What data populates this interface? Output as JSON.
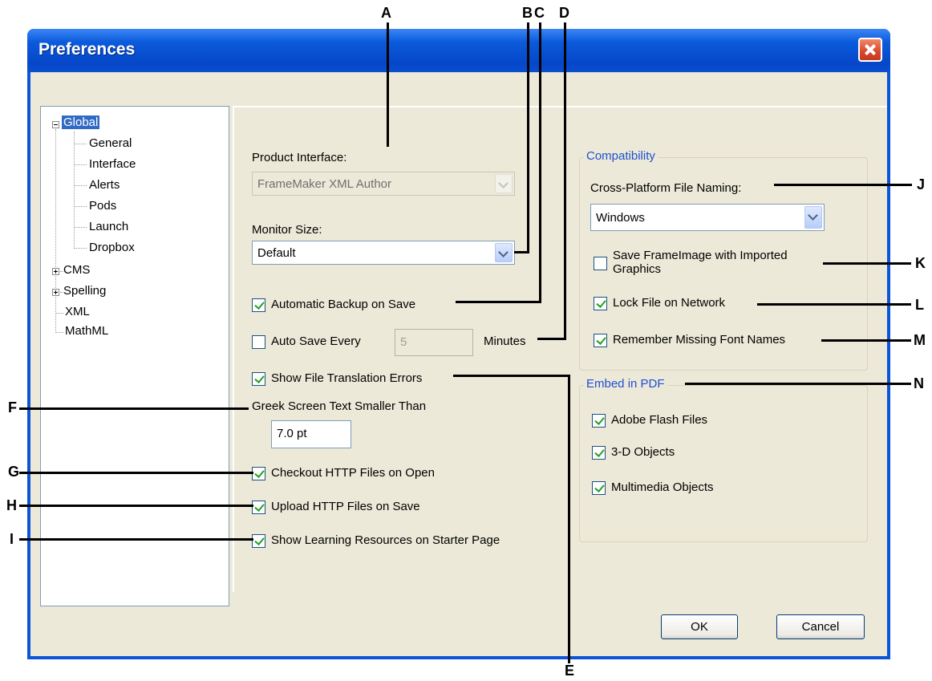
{
  "window": {
    "title": "Preferences"
  },
  "tree": {
    "root": "Global",
    "children": [
      "General",
      "Interface",
      "Alerts",
      "Pods",
      "Launch",
      "Dropbox"
    ],
    "others": [
      "CMS",
      "Spelling",
      "XML",
      "MathML"
    ]
  },
  "product_interface": {
    "label": "Product Interface:",
    "value": "FrameMaker XML Author"
  },
  "monitor_size": {
    "label": "Monitor Size:",
    "value": "Default"
  },
  "options": {
    "auto_backup": "Automatic Backup on Save",
    "auto_save": "Auto Save Every",
    "auto_save_value": "5",
    "minutes": "Minutes",
    "show_translation_errors": "Show File Translation Errors",
    "greek_label": "Greek Screen Text Smaller Than",
    "greek_value": "7.0 pt",
    "checkout_http": "Checkout HTTP Files on Open",
    "upload_http": "Upload HTTP Files on Save",
    "learning_resources": "Show Learning Resources on Starter Page"
  },
  "compatibility": {
    "title": "Compatibility",
    "naming_label": "Cross-Platform File Naming:",
    "naming_value": "Windows",
    "save_frameimage_line1": "Save FrameImage with Imported",
    "save_frameimage_line2": "Graphics",
    "lock_file": "Lock File on Network",
    "remember_fonts": "Remember Missing Font Names"
  },
  "embed_pdf": {
    "title": "Embed in PDF",
    "flash": "Adobe Flash Files",
    "objects_3d": "3-D Objects",
    "multimedia": "Multimedia Objects"
  },
  "buttons": {
    "ok": "OK",
    "cancel": "Cancel"
  },
  "callouts": {
    "A": "A",
    "B": "B",
    "C": "C",
    "D": "D",
    "E": "E",
    "F": "F",
    "G": "G",
    "H": "H",
    "I": "I",
    "J": "J",
    "K": "K",
    "L": "L",
    "M": "M",
    "N": "N"
  }
}
